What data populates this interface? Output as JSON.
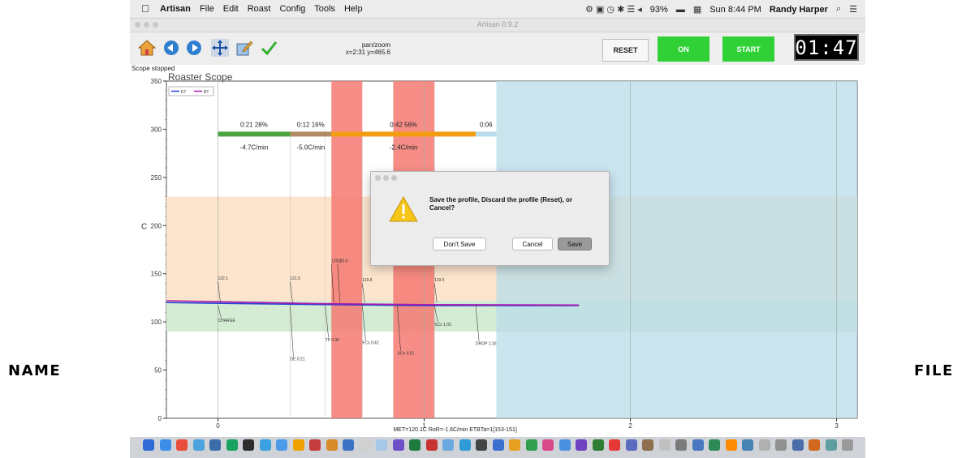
{
  "menubar": {
    "app_name": "Artisan",
    "menus": [
      "File",
      "Edit",
      "Roast",
      "Config",
      "Tools",
      "Help"
    ],
    "battery": "93%",
    "clock": "Sun 8:44 PM",
    "user": "Randy Harper"
  },
  "window": {
    "title": "Artisan 0.9.2"
  },
  "toolbar": {
    "panzoom_label": "pan/zoom",
    "coords": "x=2:31  y=465.6",
    "reset_label": "RESET",
    "on_label": "ON",
    "start_label": "START",
    "timer": "01:47"
  },
  "status": {
    "text": "Scope stopped"
  },
  "chart_data": {
    "type": "line",
    "title": "Roaster Scope",
    "ylabel": "C",
    "ylim": [
      0,
      350
    ],
    "xlim": [
      -0.25,
      3.1
    ],
    "x_ticks": [
      "0",
      "1",
      "2",
      "3"
    ],
    "y_ticks": [
      "0",
      "50",
      "100",
      "150",
      "200",
      "250",
      "300",
      "350"
    ],
    "legend": [
      "ET",
      "BT"
    ],
    "legend_position": "top-left",
    "phases": [
      {
        "time": "0:21",
        "pct": "28%",
        "ror": "-4.7C/min",
        "color": "#4aa33f"
      },
      {
        "time": "0:12",
        "pct": "16%",
        "ror": "-5.0C/min",
        "color": "#b08a64"
      },
      {
        "time": "0:42",
        "pct": "56%",
        "ror": "-2.4C/min",
        "color": "#f39c12"
      },
      {
        "time": "0:06",
        "pct": "",
        "ror": "",
        "color": "#b9dcea"
      }
    ],
    "bands": [
      {
        "from": 122,
        "to": 230,
        "color": "#fce5cc"
      },
      {
        "from": 90,
        "to": 122,
        "color": "#d4ebd4"
      }
    ],
    "red_zones": [
      [
        0.55,
        0.7
      ],
      [
        0.85,
        1.05
      ]
    ],
    "blue_zone": [
      1.35,
      3.1
    ],
    "series": [
      {
        "name": "ET",
        "color": "#2a3fd6",
        "x": [
          -0.25,
          0.5,
          1.0,
          1.75
        ],
        "y": [
          120.1,
          118.0,
          117.0,
          117.0
        ]
      },
      {
        "name": "BT",
        "color": "#b11aa8",
        "x": [
          -0.25,
          0.5,
          1.0,
          1.75
        ],
        "y": [
          122.0,
          119.0,
          118.0,
          117.5
        ]
      }
    ],
    "annotations": {
      "values": [
        "122.1",
        "121.5",
        "120.1",
        "120.6",
        "119.8",
        "119.5"
      ],
      "events": [
        "CHARGE",
        "DE 0:21",
        "TP 0:30",
        "FCs 0:42",
        "SCe 0:51",
        "SCs 1:03",
        "DROP 1:16"
      ]
    },
    "footer": "MET=120.1C  RoR=-1.6C/min  ETBTa=1[153-151]"
  },
  "dialog": {
    "message": "Save the profile, Discard the profile (Reset), or Cancel?",
    "dont_save": "Don't Save",
    "cancel": "Cancel",
    "save": "Save"
  },
  "captions": {
    "left": "NAME",
    "right": "FILE"
  }
}
